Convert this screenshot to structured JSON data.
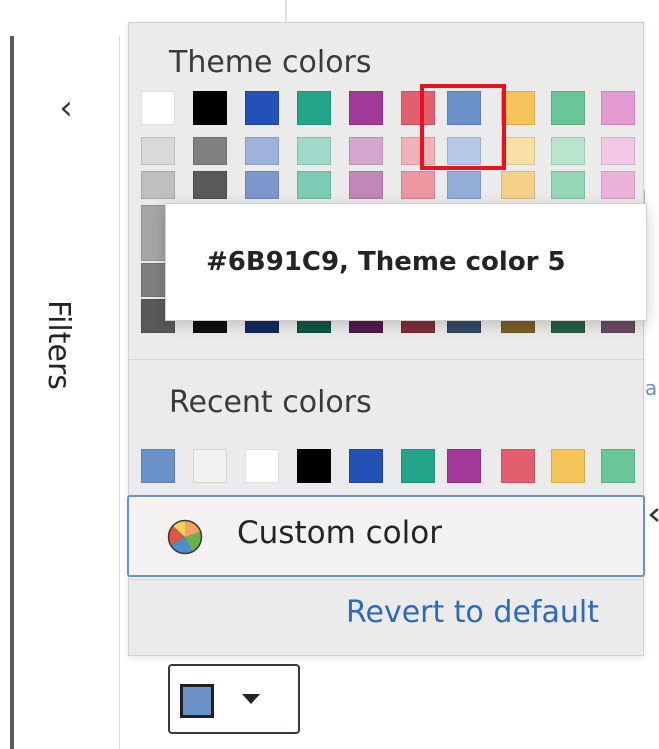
{
  "filters_pane": {
    "label": "Filters",
    "collapse_icon": "chevron-left-icon",
    "collapse_glyph": "‹"
  },
  "color_panel": {
    "theme_title": "Theme colors",
    "recent_title": "Recent colors",
    "theme_colors": [
      [
        "#ffffff",
        "#000000",
        "#2451b5",
        "#23a58a",
        "#a23898",
        "#e15f6f",
        "#6b91c9",
        "#f5c45b",
        "#6ac597",
        "#e39bd0"
      ],
      [
        "#d9d9d9",
        "#808080",
        "#9fb2dc",
        "#9ed9c9",
        "#d3a6cd",
        "#f1b1b9",
        "#b5c9e6",
        "#f8dfa8",
        "#b9e4cd",
        "#f2c8e6"
      ],
      [
        "#bfbfbf",
        "#595959",
        "#7d97cc",
        "#7ccbb5",
        "#c386b9",
        "#ec97a2",
        "#93aed8",
        "#f6d18a",
        "#95d6b4",
        "#ebb3d9"
      ],
      [
        "#a6a6a6",
        "#404040",
        "#5b7cbd",
        "#52b99b",
        "#b365a6",
        "#e67a88",
        "#7c9fd1",
        "#f4c56b",
        "#7cc9a1",
        "#e3a0cd"
      ],
      [
        "#7f7f7f",
        "#262626",
        "#1b3d87",
        "#1b7c68",
        "#7a2a72",
        "#b94553",
        "#4f6d97",
        "#b88f3c",
        "#3f8e66",
        "#a06e93"
      ],
      [
        "#595959",
        "#0d0d0d",
        "#122a5c",
        "#125447",
        "#521c4c",
        "#7f2f39",
        "#354a66",
        "#7b5f28",
        "#2a5f44",
        "#6b4a62"
      ]
    ],
    "recent_colors": [
      "#6b91c9",
      "#f3f2f1",
      "#ffffff",
      "#000000",
      "#2451b5",
      "#23a58a",
      "#a23898",
      "#e15f6f",
      "#f5c45b",
      "#6ac597"
    ],
    "tooltip_text": "#6B91C9, Theme color 5",
    "highlight_color": "#e81123",
    "custom_color_label": "Custom color",
    "custom_color_icon": "color-wheel-icon",
    "revert_label": "Revert to default"
  },
  "picker_button": {
    "current_color": "#6b91c9",
    "caret_icon": "caret-down-icon"
  },
  "background": {
    "partial_letter": "a",
    "accent": "#6b91c9"
  }
}
